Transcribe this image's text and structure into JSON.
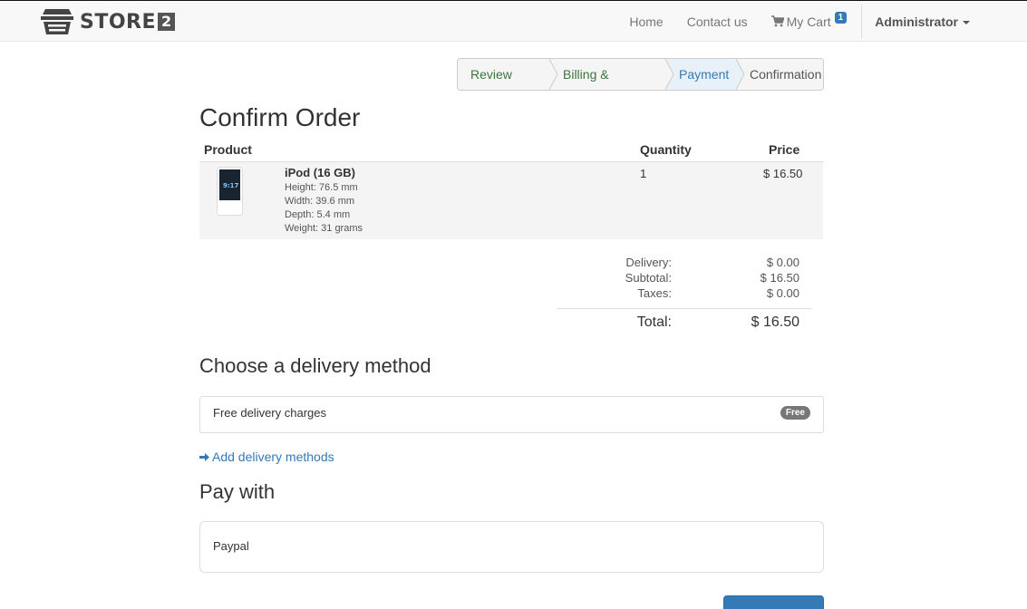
{
  "navbar": {
    "brand_text": "STORE",
    "brand_number": "2",
    "links": [
      {
        "label": "Home"
      },
      {
        "label": "Contact us"
      }
    ],
    "cart": {
      "label": "My Cart",
      "count": "1"
    },
    "user": {
      "label": "Administrator"
    }
  },
  "steps": [
    {
      "label": "Review Order",
      "state": "done"
    },
    {
      "label": "Billing & Shipping",
      "state": "done"
    },
    {
      "label": "Payment",
      "state": "active"
    },
    {
      "label": "Confirmation",
      "state": "todo"
    }
  ],
  "page_title": "Confirm Order",
  "table": {
    "headers": {
      "product": "Product",
      "quantity": "Quantity",
      "price": "Price"
    },
    "rows": [
      {
        "thumb_text": "9:17",
        "name": "iPod (16 GB)",
        "specs": [
          "Height: 76.5 mm",
          "Width: 39.6 mm",
          "Depth: 5.4 mm",
          "Weight: 31 grams"
        ],
        "quantity": "1",
        "price": "$ 16.50"
      }
    ]
  },
  "summary": {
    "delivery_label": "Delivery:",
    "delivery_value": "$ 0.00",
    "subtotal_label": "Subtotal:",
    "subtotal_value": "$ 16.50",
    "taxes_label": "Taxes:",
    "taxes_value": "$ 0.00",
    "total_label": "Total:",
    "total_value": "$ 16.50"
  },
  "delivery": {
    "heading": "Choose a delivery method",
    "option_label": "Free delivery charges",
    "option_badge": "Free",
    "add_link": "Add delivery methods"
  },
  "payment": {
    "heading": "Pay with",
    "option_label": "Paypal"
  },
  "colors": {
    "accent": "#337ab7",
    "done": "#3c763d"
  }
}
